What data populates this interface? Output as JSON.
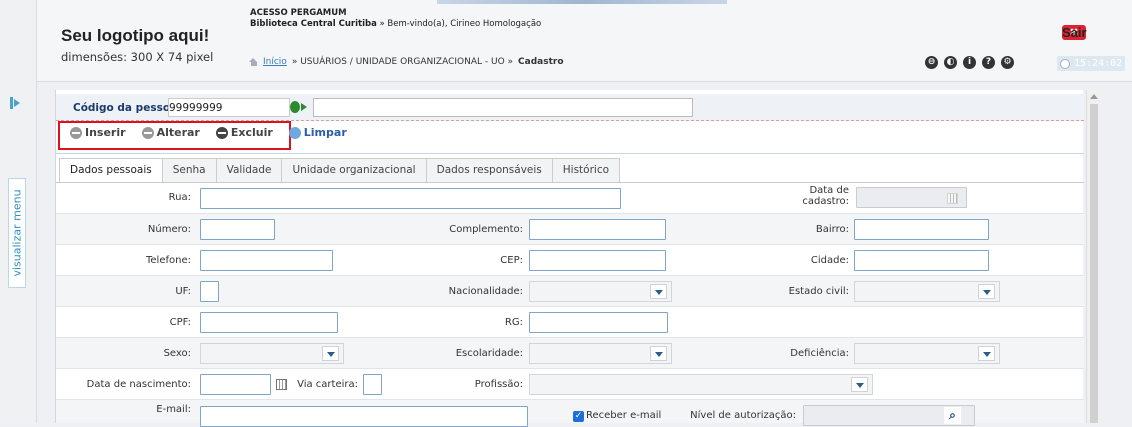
{
  "header": {
    "logo_title": "Seu logotipo aqui!",
    "logo_sub": "dimensões: 300 X 74 pixel",
    "system_name": "ACESSO PERGAMUM",
    "library": "Biblioteca Central Curitiba",
    "welcome": " » Bem-vindo(a), Cirineo Homologação",
    "breadcrumb": {
      "home": "Início",
      "path": "» USUÁRIOS / UNIDADE ORGANIZACIONAL - UO »",
      "current": "Cadastro"
    },
    "logout_label": "Sair",
    "clock": "15:24:02",
    "tool_icons": [
      "help-icon",
      "user-icon",
      "info-icon",
      "question-icon",
      "settings-icon"
    ]
  },
  "sidebar": {
    "menu_label": "visualizar menu"
  },
  "person": {
    "label": "Código da pessoa:",
    "code": "99999999",
    "name": ""
  },
  "actions": {
    "insert": "Inserir",
    "edit": "Alterar",
    "delete": "Excluir",
    "clear": "Limpar"
  },
  "tabs": [
    {
      "label": "Dados pessoais",
      "active": true
    },
    {
      "label": "Senha"
    },
    {
      "label": "Validade"
    },
    {
      "label": "Unidade organizacional"
    },
    {
      "label": "Dados responsáveis"
    },
    {
      "label": "Histórico"
    }
  ],
  "form": {
    "rua": "Rua:",
    "data_cadastro_1": "Data de",
    "data_cadastro_2": "cadastro:",
    "numero": "Número:",
    "complemento": "Complemento:",
    "bairro": "Bairro:",
    "telefone": "Telefone:",
    "cep": "CEP:",
    "cidade": "Cidade:",
    "uf": "UF:",
    "nacionalidade": "Nacionalidade:",
    "estado_civil": "Estado civil:",
    "cpf": "CPF:",
    "rg": "RG:",
    "sexo": "Sexo:",
    "escolaridade": "Escolaridade:",
    "deficiencia": "Deficiência:",
    "data_nascimento": "Data de nascimento:",
    "via_carteira": "Via carteira:",
    "profissao": "Profissão:",
    "email": "E-mail:",
    "receber_email": "Receber e-mail",
    "nivel_autorizacao": "Nível de autorização:"
  }
}
